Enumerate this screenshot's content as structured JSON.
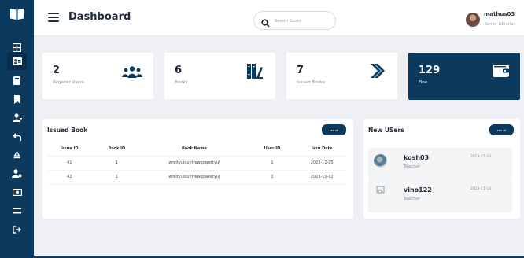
{
  "header": {
    "title": "Dashboard",
    "search_placeholder": "Search Books",
    "user": {
      "name": "mathus03",
      "role": "Senior Librarian"
    }
  },
  "sidebar": {
    "items": [
      {
        "icon": "grid-icon"
      },
      {
        "icon": "id-card-icon"
      },
      {
        "icon": "book-icon"
      },
      {
        "icon": "bookmark-icon"
      },
      {
        "icon": "user-hand-icon"
      },
      {
        "icon": "return-arrow-icon"
      },
      {
        "icon": "recycle-icon"
      },
      {
        "icon": "user-gear-icon"
      },
      {
        "icon": "money-icon"
      },
      {
        "icon": "list-icon"
      },
      {
        "icon": "logout-icon"
      }
    ],
    "active_index": 1
  },
  "stats": [
    {
      "value": "2",
      "label": "Register Users",
      "icon": "users-icon"
    },
    {
      "value": "6",
      "label": "Books",
      "icon": "book-shelf-icon"
    },
    {
      "value": "7",
      "label": "Issued Books",
      "icon": "double-chevron-icon"
    },
    {
      "value": "129",
      "label": "Fine",
      "icon": "wallet-icon"
    }
  ],
  "issued": {
    "title": "Issued Book",
    "see_all": "see all",
    "columns": [
      "Issue ID",
      "Book ID",
      "Book Name",
      "User ID",
      "Issu Date"
    ],
    "rows": [
      [
        "41",
        "1",
        "wreltyuiouytrewqowertyuj",
        "1",
        "2023-12-05"
      ],
      [
        "42",
        "1",
        "wreltyuiouytrewqowertyuj",
        "2",
        "2023-10-02"
      ]
    ]
  },
  "new_users": {
    "title": "New USers",
    "see_all": "see all",
    "items": [
      {
        "name": "kosh03",
        "role": "Teacher",
        "date": "2023-11-14"
      },
      {
        "name": "vino122",
        "role": "Teacher",
        "date": "2023-11-14"
      }
    ]
  },
  "colors": {
    "brand": "#0b3a5e",
    "background": "#eef0f3"
  }
}
